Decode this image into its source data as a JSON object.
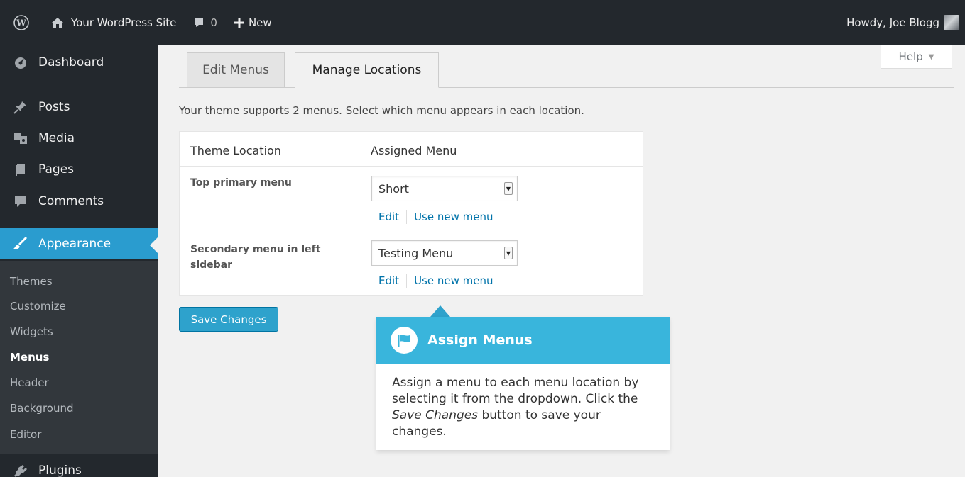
{
  "adminbar": {
    "site_name": "Your WordPress Site",
    "comments_count": "0",
    "new_label": "New",
    "howdy": "Howdy, Joe Blogg"
  },
  "sidebar": {
    "items": [
      {
        "label": "Dashboard",
        "icon": "dashboard-icon"
      },
      {
        "label": "Posts",
        "icon": "pin-icon"
      },
      {
        "label": "Media",
        "icon": "media-icon"
      },
      {
        "label": "Pages",
        "icon": "pages-icon"
      },
      {
        "label": "Comments",
        "icon": "comment-icon"
      },
      {
        "label": "Appearance",
        "icon": "brush-icon"
      },
      {
        "label": "Plugins",
        "icon": "plug-icon"
      }
    ],
    "submenu": [
      "Themes",
      "Customize",
      "Widgets",
      "Menus",
      "Header",
      "Background",
      "Editor"
    ],
    "active_submenu": "Menus"
  },
  "help_tab": {
    "label": "Help"
  },
  "tabs": [
    {
      "label": "Edit Menus",
      "active": false
    },
    {
      "label": "Manage Locations",
      "active": true
    }
  ],
  "intro": "Your theme supports 2 menus. Select which menu appears in each location.",
  "table": {
    "headers": [
      "Theme Location",
      "Assigned Menu"
    ],
    "rows": [
      {
        "location": "Top primary menu",
        "menu": "Short",
        "edit": "Edit",
        "use_new": "Use new menu"
      },
      {
        "location": "Secondary menu in left sidebar",
        "menu": "Testing Menu",
        "edit": "Edit",
        "use_new": "Use new menu"
      }
    ]
  },
  "save_button": "Save Changes",
  "pointer": {
    "title": "Assign Menus",
    "body_1": "Assign a menu to each menu location by selecting it from the dropdown. Click the ",
    "body_em": "Save Changes",
    "body_2": " button to save your changes."
  },
  "colors": {
    "accent": "#2ea2cc",
    "admin_dark": "#23282d",
    "link": "#0073aa"
  }
}
